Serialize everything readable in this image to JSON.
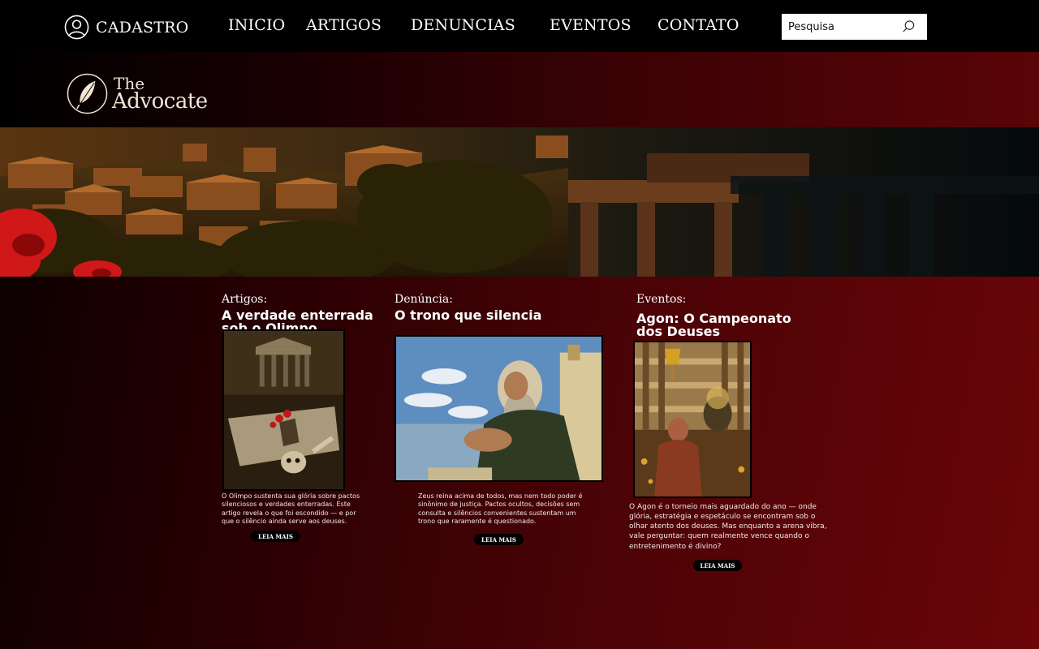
{
  "nav": {
    "register_label": "CADASTRO",
    "items": [
      {
        "label": "INICIO"
      },
      {
        "label": "ARTIGOS"
      },
      {
        "label": "DENUNCIAS"
      },
      {
        "label": "EVENTOS"
      },
      {
        "label": "CONTATO"
      }
    ],
    "search_placeholder": "Pesquisa"
  },
  "logo": {
    "line1": "The",
    "line2": "Advocate"
  },
  "cards": [
    {
      "category": "Artigos:",
      "title": "A verdade enterrada sob o Olimpo",
      "description": "O Olimpo sustenta sua glória sobre pactos silenciosos e verdades enterradas. Este artigo revela o que foi escondido — e por que o silêncio ainda serve aos deuses.",
      "button": "LEIA MAIS"
    },
    {
      "category": "Denúncia:",
      "title": "O trono que silencia",
      "description": "Zeus reina acima de todos, mas nem todo poder é sinônimo de justiça. Pactos ocultos, decisões sem consulta e silêncios convenientes sustentam um trono que raramente é questionado.",
      "button": "LEIA MAIS"
    },
    {
      "category": "Eventos:",
      "title": "Agon: O Campeonato dos Deuses",
      "description": "O Agon é o torneio mais aguardado do ano — onde glória, estratégia e espetáculo se encontram sob o olhar atento dos deuses. Mas enquanto a arena vibra, vale perguntar: quem realmente vence quando o entretenimento é divino?",
      "button": "LEIA MAIS"
    }
  ],
  "icons": {
    "user": "user-circle-icon",
    "search": "search-icon",
    "logo": "feather-quill-icon"
  },
  "colors": {
    "topbar": "#000000",
    "accent_dark_red": "#6a0508",
    "logo_text": "#f2e6d4",
    "search_bg": "#ffffff"
  }
}
